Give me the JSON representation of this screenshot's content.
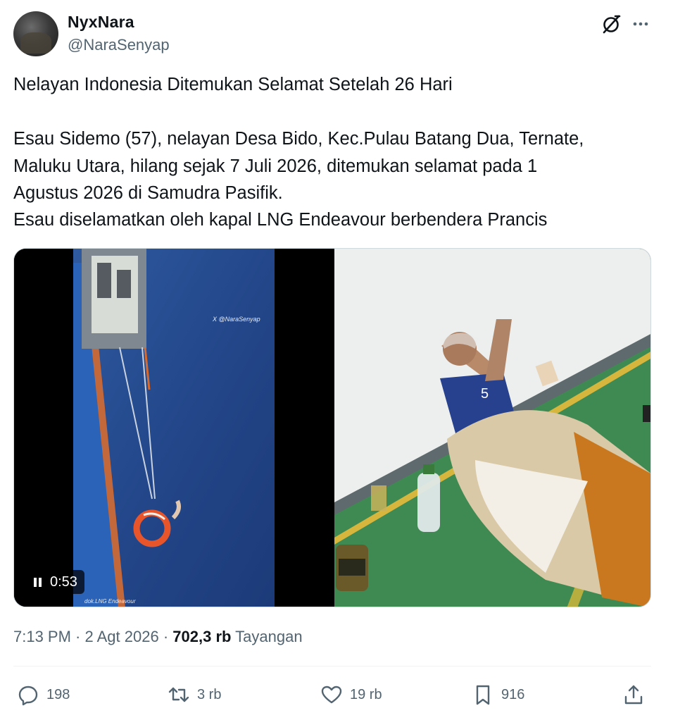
{
  "author": {
    "name": "NyxNara",
    "handle": "@NaraSenyap"
  },
  "tweet": {
    "lines": [
      "Nelayan Indonesia Ditemukan Selamat Setelah 26 Hari",
      "Esau Sidemo (57), nelayan Desa Bido, Kec.Pulau Batang Dua, Ternate,",
      "Maluku Utara, hilang sejak 7 Juli 2026, ditemukan selamat pada 1",
      "Agustus 2026 di Samudra Pasifik.",
      "Esau diselamatkan oleh kapal LNG Endeavour berbendera Prancis"
    ]
  },
  "media": {
    "video_watermark": "X @NaraSenyap",
    "video_credit": "dok.LNG Endeavour",
    "video_duration": "0:53",
    "shirt_number": "5"
  },
  "meta": {
    "time": "7:13 PM",
    "sep1": " · ",
    "date": "2 Agt 2026",
    "sep2": " · ",
    "views": "702,3 rb",
    "views_label": "Tayangan"
  },
  "actions": {
    "replies": "198",
    "reposts": "3 rb",
    "likes": "19 rb",
    "bookmarks": "916"
  },
  "colors": {
    "text": "#0f1419",
    "secondary": "#536471",
    "border": "#cfd9de"
  }
}
